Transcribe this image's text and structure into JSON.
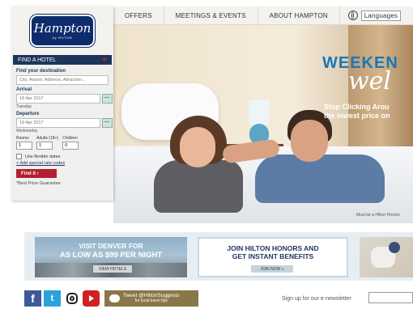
{
  "nav": {
    "items": [
      "OFFERS",
      "MEETINGS & EVENTS",
      "ABOUT HAMPTON"
    ],
    "language_label": "Languages"
  },
  "logo": {
    "name": "Hampton",
    "sub": "by HILTON"
  },
  "booking": {
    "header": "FIND A HOTEL",
    "destination_label": "Find your destination",
    "destination_placeholder": "City, Airport, Address, Attraction...",
    "arrival_label": "Arrival",
    "arrival_value": "18 Apr 2017",
    "arrival_day": "Tuesday",
    "departure_label": "Departure",
    "departure_value": "19 Apr 2017",
    "departure_day": "Wednesday",
    "rooms_label": "Rooms",
    "rooms_value": "1",
    "adults_label": "Adults (18+)",
    "adults_value": "1",
    "children_label": "Children",
    "children_value": "0",
    "flexible_label": "Use flexible dates",
    "special_rate_label": "Add special rate codes",
    "find_button": "Find it",
    "guarantee": "*Best Price Guarantee"
  },
  "hero": {
    "headline1": "WEEKEN",
    "headline2": "wel",
    "subline1": "Stop Clicking Arou",
    "subline2": "the lowest price on",
    "fineprint": "Must be a Hilton Honors"
  },
  "promos": [
    {
      "line1": "VISIT DENVER FOR",
      "line2": "AS LOW AS $99 PER NIGHT",
      "button": "VIEW HOTELS"
    },
    {
      "line1": "JOIN HILTON HONORS AND",
      "line2": "GET INSTANT BENEFITS",
      "button": "JOIN NOW »"
    }
  ],
  "footer": {
    "tweet_line1": "Tweet @HiltonSuggests",
    "tweet_line2": "for local travel tips",
    "newsletter_label": "Sign up for our e-newsletter",
    "fb_glyph": "f",
    "tw_glyph": "t"
  },
  "colors": {
    "navy": "#1d355d",
    "hilton_red": "#b51f2e",
    "hero_blue": "#1877b7"
  }
}
